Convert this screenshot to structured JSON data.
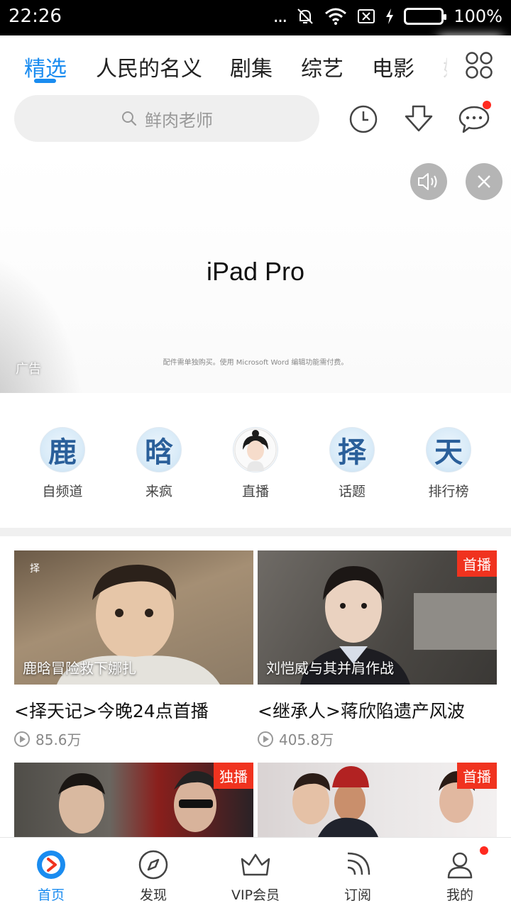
{
  "status_bar": {
    "time": "22:26",
    "more": "...",
    "battery_percent": "100%",
    "battery_level": 1.0
  },
  "tabs": [
    {
      "label": "精选",
      "active": true
    },
    {
      "label": "人民的名义",
      "active": false
    },
    {
      "label": "剧集",
      "active": false
    },
    {
      "label": "综艺",
      "active": false
    },
    {
      "label": "电影",
      "active": false
    }
  ],
  "search": {
    "placeholder": "鲜肉老师"
  },
  "ad": {
    "title": "iPad Pro",
    "fine_print": "配件需单独购买。使用 Microsoft Word 编辑功能需付费。",
    "label": "广告"
  },
  "channels": [
    {
      "glyph": "鹿",
      "label": "自频道"
    },
    {
      "glyph": "晗",
      "label": "来疯"
    },
    {
      "glyph": "",
      "label": "直播"
    },
    {
      "glyph": "择",
      "label": "话题"
    },
    {
      "glyph": "天",
      "label": "排行榜"
    }
  ],
  "videos": [
    {
      "overlay": "鹿晗冒险救下娜扎",
      "title": "<择天记>今晚24点首播",
      "plays": "85.6万",
      "badge": ""
    },
    {
      "overlay": "刘恺威与其并肩作战",
      "title": "<继承人>蒋欣陷遗产风波",
      "plays": "405.8万",
      "badge": "首播"
    },
    {
      "overlay": "",
      "title": "",
      "plays": "",
      "badge": "独播"
    },
    {
      "overlay": "",
      "title": "",
      "plays": "",
      "badge": "首播"
    }
  ],
  "bottom_nav": [
    {
      "label": "首页",
      "icon": "home-play-icon",
      "active": true
    },
    {
      "label": "发现",
      "icon": "compass-icon",
      "active": false
    },
    {
      "label": "VIP会员",
      "icon": "crown-icon",
      "active": false
    },
    {
      "label": "订阅",
      "icon": "rss-icon",
      "active": false
    },
    {
      "label": "我的",
      "icon": "user-icon",
      "active": false
    }
  ],
  "colors": {
    "accent": "#1a8cf0",
    "badge": "#f0331f",
    "notification_dot": "#ff2a1f"
  }
}
